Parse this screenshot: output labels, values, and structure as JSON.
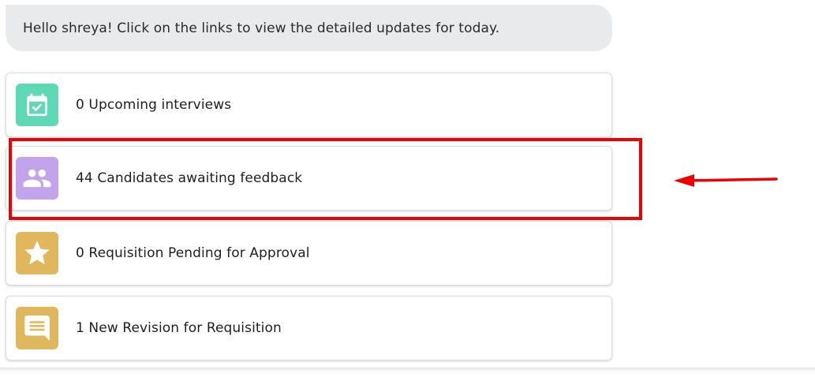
{
  "greeting": {
    "text": "Hello shreya! Click on the links to view the detailed updates for today."
  },
  "updates": [
    {
      "label": "0 Upcoming interviews",
      "icon": "calendar-check-icon",
      "color": "#5ed8b5"
    },
    {
      "label": "44 Candidates awaiting feedback",
      "icon": "group-users-icon",
      "color": "#c3a4ec"
    },
    {
      "label": "0 Requisition Pending for Approval",
      "icon": "star-icon",
      "color": "#e0b75c"
    },
    {
      "label": "1 New Revision for Requisition",
      "icon": "message-icon",
      "color": "#e0b75c"
    }
  ],
  "annotation": {
    "highlight_color": "#ee0000",
    "highlighted_item": "44 Candidates awaiting feedback"
  }
}
